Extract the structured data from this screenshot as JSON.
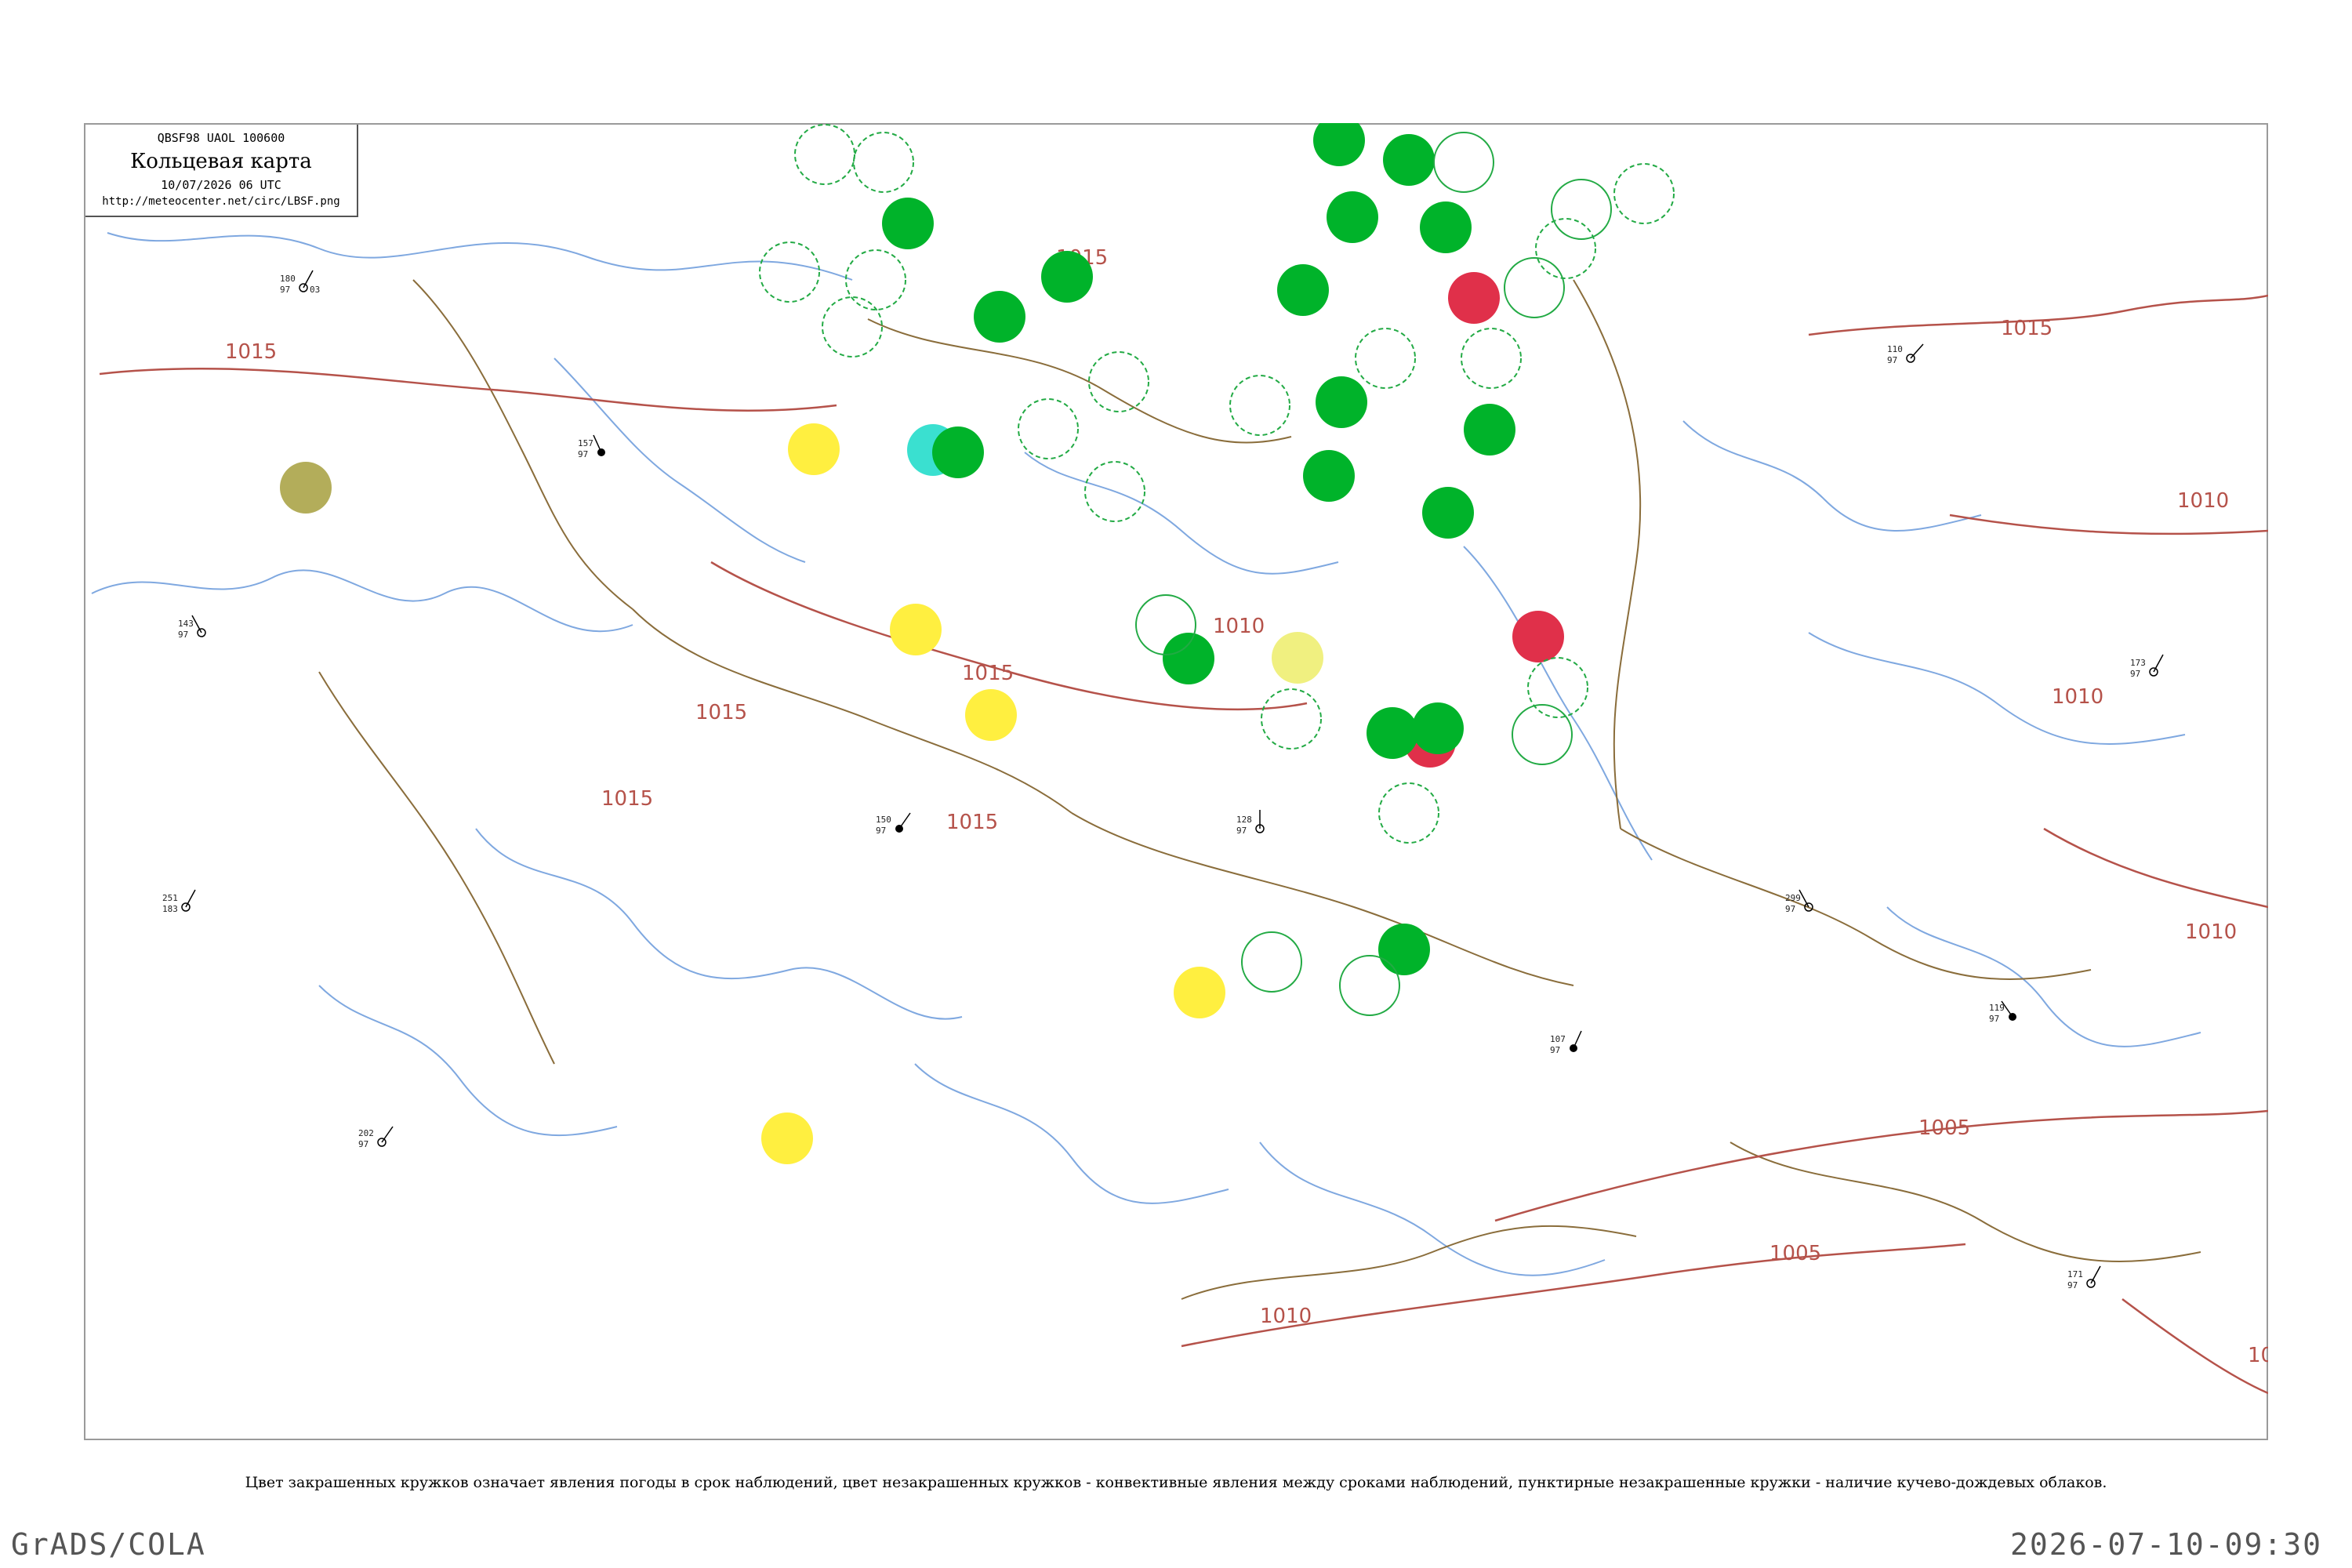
{
  "header": {
    "bulletin": "QBSF98  UAOL  100600",
    "title": "Кольцевая карта",
    "datetime": "10/07/2026 06 UTC",
    "url": "http://meteocenter.net/circ/LBSF.png"
  },
  "legend": "Цвет закрашенных кружков означает явления погоды в срок наблюдений, цвет незакрашенных кружков - конвективные явления между сроками наблюдений, пунктирные незакрашенные кружки - наличие кучево-дождевых облаков.",
  "footer": {
    "left": "GrADS/COLA",
    "right": "2026-07-10-09:30"
  },
  "isobars": [
    "1015",
    "1015",
    "1015",
    "1015",
    "1015",
    "1015",
    "1015",
    "1010",
    "1010",
    "1010",
    "1010",
    "1010",
    "1005",
    "1005",
    "10"
  ],
  "colors": {
    "coast": "#7fa8e0",
    "border": "#8a6d3b",
    "isobar": "#b5524a",
    "precip_green": "#00b32a",
    "thunder_red": "#e0304a",
    "fog_yellow": "#ffef40",
    "drizzle_olive": "#b3ad5a",
    "shower_cyan": "#3ae0d0",
    "conv_green": "#22aa44",
    "haze_yellow": "#f0f080"
  },
  "station_samples": [
    "180",
    "97",
    "03",
    "157",
    "150",
    "128",
    "110",
    "119",
    "173",
    "143",
    "202",
    "107",
    "299",
    "171",
    "251",
    "183"
  ]
}
